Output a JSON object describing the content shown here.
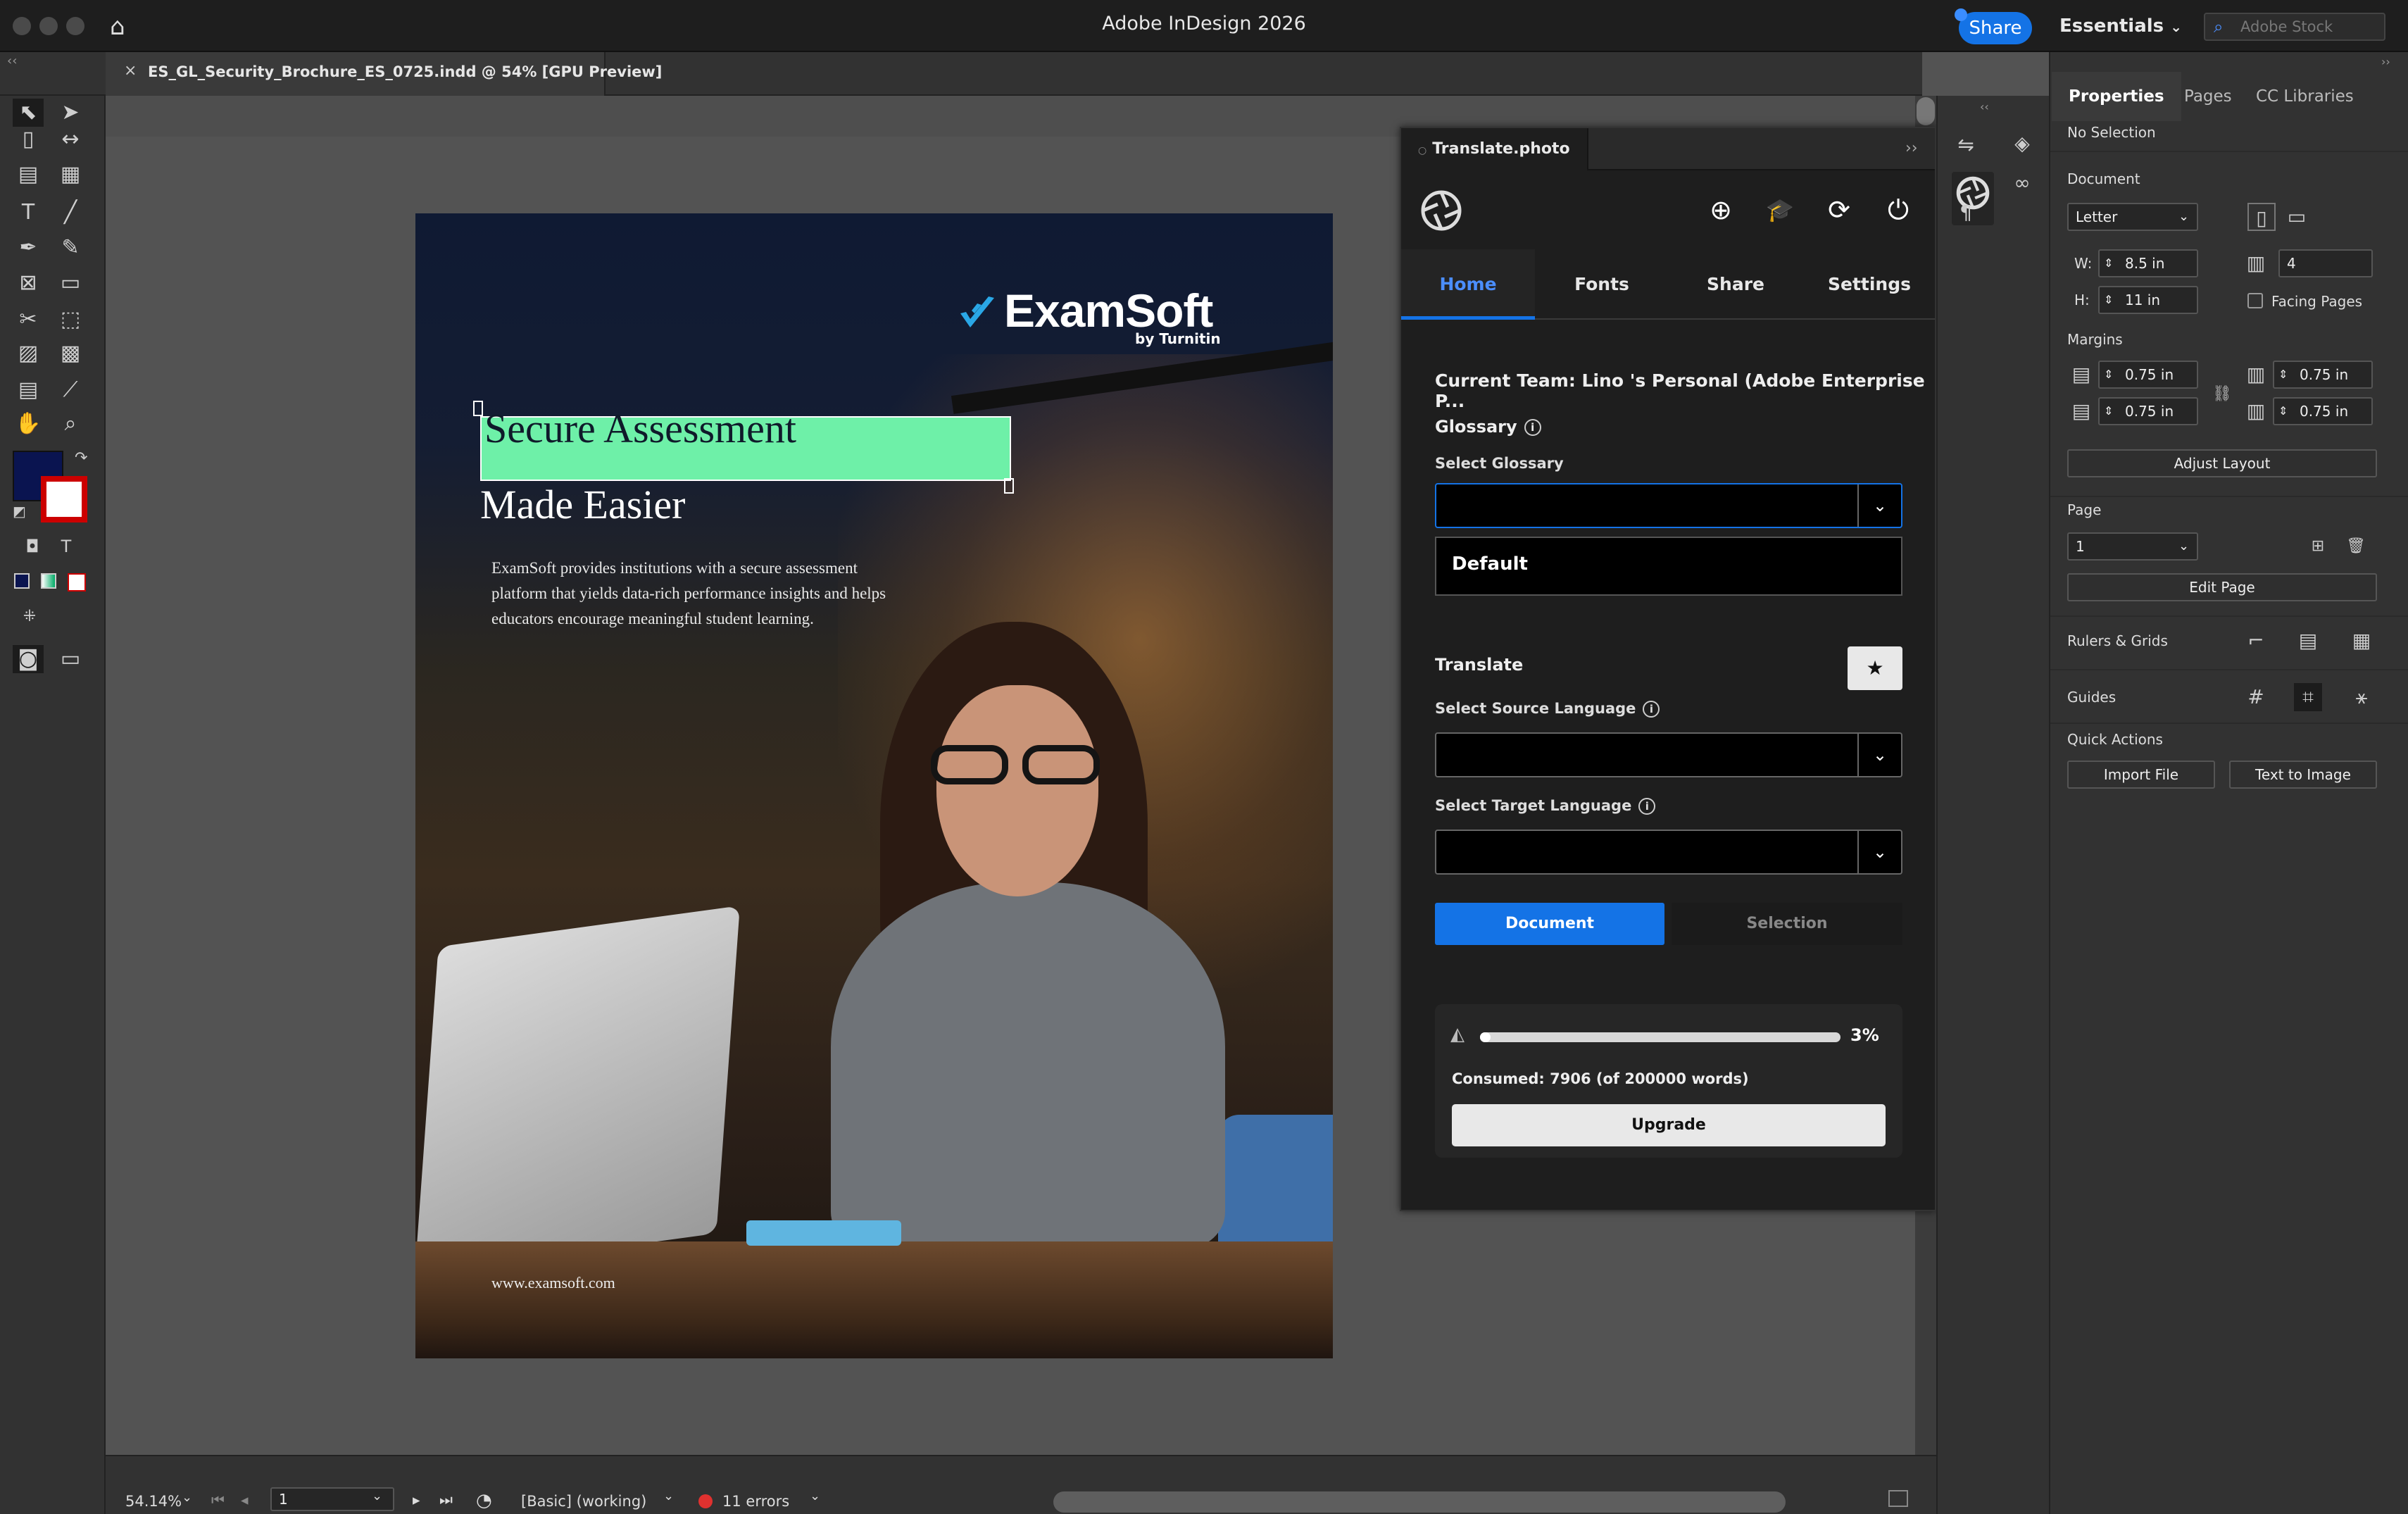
{
  "window": {
    "title": "Adobe InDesign 2026"
  },
  "topbar": {
    "share_label": "Share",
    "workspace": "Essentials",
    "search_placeholder": "Adobe Stock"
  },
  "document_tab": {
    "label": "ES_GL_Security_Brochure_ES_0725.indd @ 54% [GPU Preview]"
  },
  "page_content": {
    "logo_text": "ExamSoft",
    "logo_sub": "by Turnitin",
    "headline_1": "Secure Assessment",
    "headline_2": "Made Easier",
    "description": "ExamSoft provides institutions with a secure assessment platform that yields data-rich performance insights and helps educators encourage meaningful student learning.",
    "url": "www.examsoft.com"
  },
  "status_bar": {
    "zoom": "54.14%",
    "page": "1",
    "profile": "[Basic] (working)",
    "errors": "11 errors"
  },
  "plugin": {
    "title": "Translate.photo",
    "tabs": [
      "Home",
      "Fonts",
      "Share",
      "Settings"
    ],
    "current_team": "Current Team: Lino 's Personal (Adobe Enterprise P...",
    "glossary_label": "Glossary",
    "select_glossary": "Select Glossary",
    "glossary_option": "Default",
    "translate_label": "Translate",
    "source_label": "Select Source Language",
    "target_label": "Select Target Language",
    "mode_document": "Document",
    "mode_selection": "Selection",
    "progress_percent": 3,
    "progress_label": "3%",
    "consumed": "Consumed: 7906 (of 200000 words)",
    "upgrade": "Upgrade"
  },
  "properties": {
    "tabs": [
      "Properties",
      "Pages",
      "CC Libraries"
    ],
    "selection": "No Selection",
    "document_label": "Document",
    "page_size": "Letter",
    "w_label": "W:",
    "w": "8.5 in",
    "h_label": "H:",
    "h": "11 in",
    "pages": "4",
    "facing_pages": "Facing Pages",
    "margins_label": "Margins",
    "margin_top": "0.75 in",
    "margin_bottom": "0.75 in",
    "margin_left": "0.75 in",
    "margin_right": "0.75 in",
    "adjust_layout": "Adjust Layout",
    "page_label": "Page",
    "page_value": "1",
    "edit_page": "Edit Page",
    "rulers_grids": "Rulers & Grids",
    "guides": "Guides",
    "quick_actions": "Quick Actions",
    "import_file": "Import File",
    "text_to_image": "Text to Image"
  },
  "colors": {
    "accent": "#1473e6",
    "highlight": "#6ef0a8",
    "fill_swatch": "#0a1450"
  }
}
